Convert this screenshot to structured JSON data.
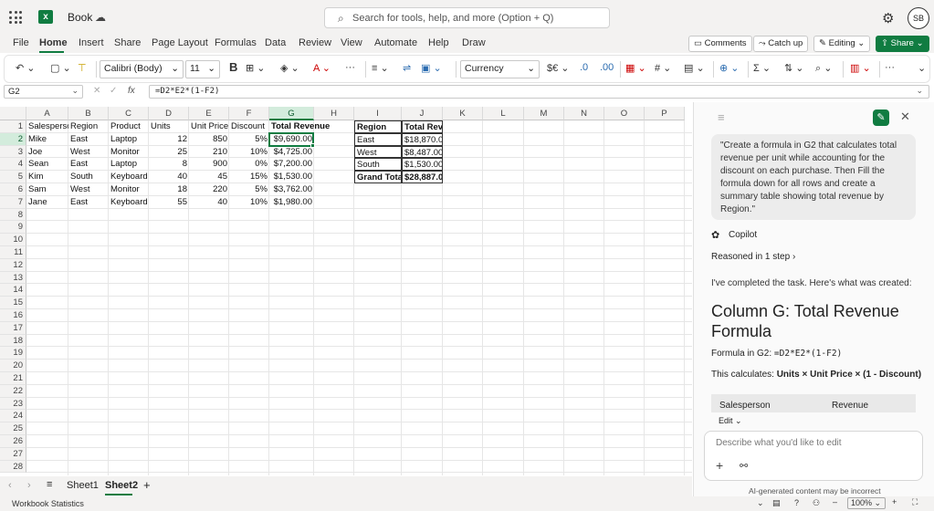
{
  "titlebar": {
    "app": "Book",
    "search_placeholder": "Search for tools, help, and more (Option + Q)",
    "avatar": "SB"
  },
  "menu": {
    "items": [
      "File",
      "Home",
      "Insert",
      "Share",
      "Page Layout",
      "Formulas",
      "Data",
      "Review",
      "View",
      "Automate",
      "Help",
      "Draw"
    ],
    "active": "Home",
    "comments": "Comments",
    "catch_up": "Catch up",
    "editing": "Editing",
    "share": "Share"
  },
  "ribbon": {
    "font_name": "Calibri (Body)",
    "font_size": "11",
    "bold": "B",
    "number_format": "Currency"
  },
  "formula_bar": {
    "name_box": "G2",
    "fx": "fx",
    "formula": "=D2*E2*(1-F2)"
  },
  "grid": {
    "columns": [
      "A",
      "B",
      "C",
      "D",
      "E",
      "F",
      "G",
      "H",
      "I",
      "J",
      "K",
      "L",
      "M",
      "N",
      "O",
      "P"
    ],
    "selected_column": "G",
    "rows": [
      "1",
      "2",
      "3",
      "4",
      "5",
      "6",
      "7",
      "8",
      "9",
      "10",
      "11",
      "12",
      "13",
      "14",
      "15",
      "16",
      "17",
      "18",
      "19",
      "20",
      "21",
      "22",
      "23",
      "24",
      "25",
      "26",
      "27",
      "28"
    ],
    "selected_row": "2",
    "headers": [
      "Salesperson",
      "Region",
      "Product",
      "Units",
      "Unit Price",
      "Discount",
      "Total Revenue"
    ],
    "data": [
      [
        "Mike",
        "East",
        "Laptop",
        "12",
        "850",
        "5%",
        "$9,690.00"
      ],
      [
        "Joe",
        "West",
        "Monitor",
        "25",
        "210",
        "10%",
        "$4,725.00"
      ],
      [
        "Sean",
        "East",
        "Laptop",
        "8",
        "900",
        "0%",
        "$7,200.00"
      ],
      [
        "Kim",
        "South",
        "Keyboard",
        "40",
        "45",
        "15%",
        "$1,530.00"
      ],
      [
        "Sam",
        "West",
        "Monitor",
        "18",
        "220",
        "5%",
        "$3,762.00"
      ],
      [
        "Jane",
        "East",
        "Keyboard",
        "55",
        "40",
        "10%",
        "$1,980.00"
      ]
    ],
    "summary_headers": [
      "Region",
      "Total Revenue"
    ],
    "summary": [
      [
        "East",
        "$18,870.00"
      ],
      [
        "West",
        "$8,487.00"
      ],
      [
        "South",
        "$1,530.00"
      ],
      [
        "Grand Total",
        "$28,887.00"
      ]
    ]
  },
  "tabs": {
    "sheets": [
      "Sheet1",
      "Sheet2"
    ],
    "active": "Sheet2",
    "add": "+"
  },
  "status": {
    "left": "Workbook Statistics",
    "zoom": "100%"
  },
  "copilot": {
    "prompt_lines": [
      "\"Create a formula in G2 that calculates total",
      "revenue per unit while accounting for the",
      "discount on each purchase. Then Fill the",
      "formula down for all rows and create a",
      "summary table showing total revenue by",
      "Region.\""
    ],
    "name": "Copilot",
    "reasoned": "Reasoned in 1 step",
    "completed": "I've completed the task. Here's what was created:",
    "heading_lines": [
      "Column G: Total Revenue",
      "Formula"
    ],
    "formula_label": "Formula in G2: ",
    "formula_value": "=D2*E2*(1-F2)",
    "calc_label": "This calculates: ",
    "calc_value": "Units × Unit Price × (1 - Discount)",
    "table_headers": [
      "Salesperson",
      "Revenue"
    ],
    "edit_label": "Edit",
    "input_placeholder": "Describe what you'd like to edit",
    "disclaimer": "AI-generated content may be incorrect"
  },
  "colors": {
    "accent": "#107c41",
    "selection_fill": "#d3ecdc"
  }
}
